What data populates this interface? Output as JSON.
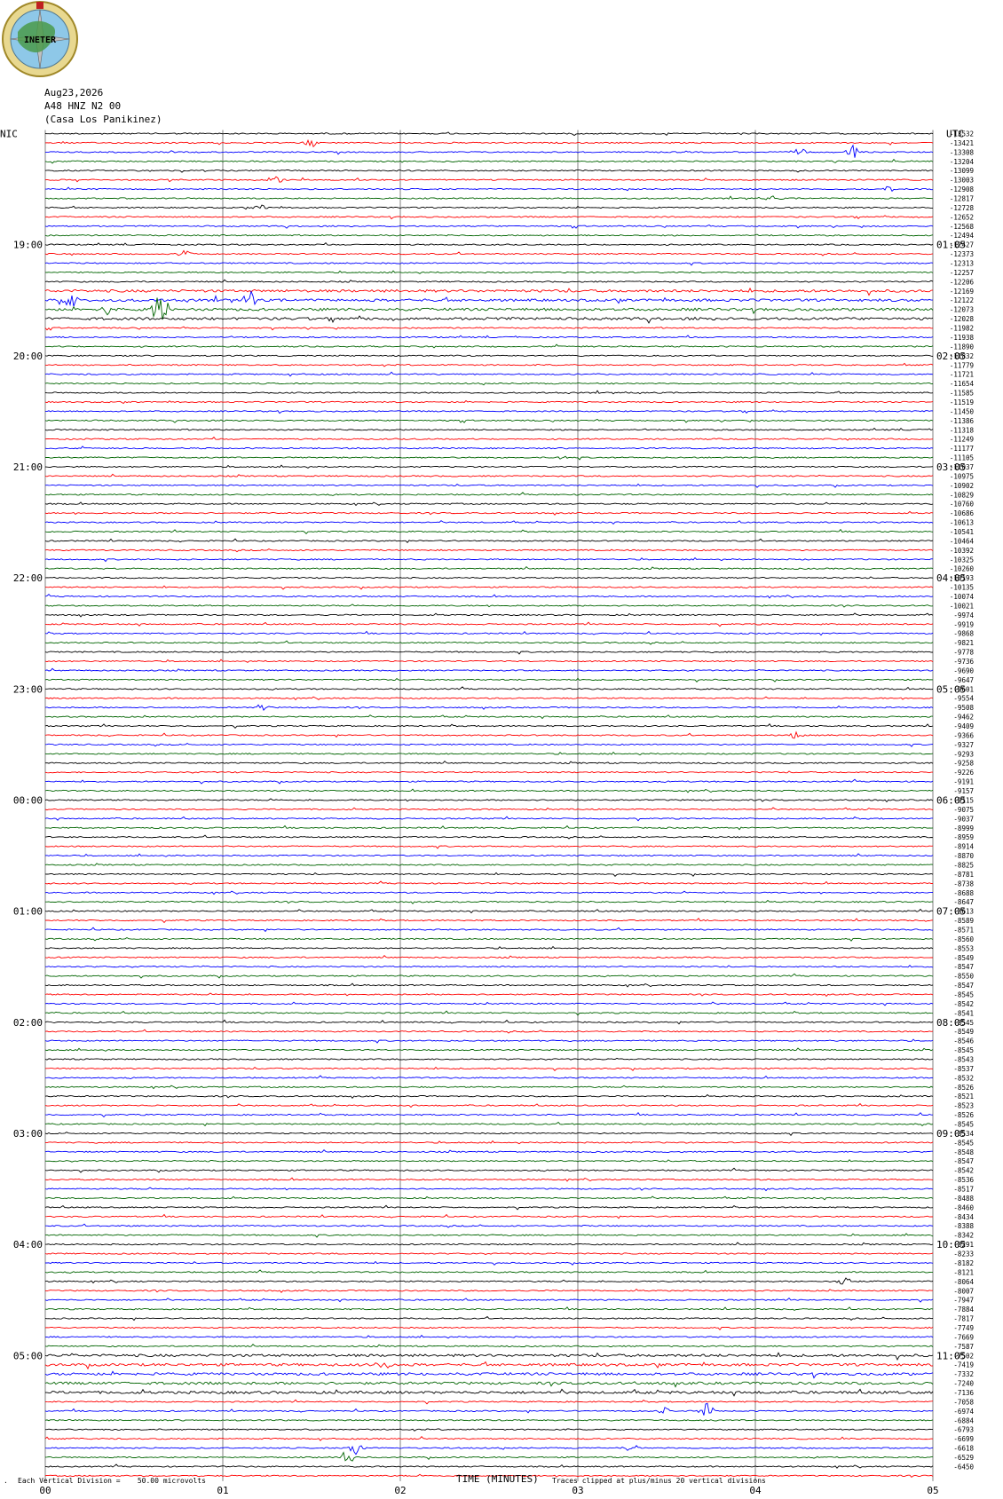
{
  "header": {
    "date": "Aug23,2026",
    "station": "A48 HNZ N2 00",
    "site": "(Casa Los Panikinez)",
    "logo_text": "INETER"
  },
  "left_zone": "NIC",
  "right_zone": "UTC",
  "colors": {
    "trace": [
      "#000000",
      "#ff0000",
      "#0000ff",
      "#006400"
    ],
    "grid": "#808080"
  },
  "footer": {
    "division": "Each Vertical Division =    50.00 microvolts",
    "xlabel": "TIME (MINUTES)",
    "clip": "Traces clipped at plus/minus 20 vertical divisions"
  },
  "chart_data": {
    "type": "line",
    "xlabel": "TIME (MINUTES)",
    "xlim": [
      0,
      5
    ],
    "x_ticks": [
      "00",
      "01",
      "02",
      "03",
      "04",
      "05"
    ],
    "rows": 146,
    "color_cycle": [
      "black",
      "red",
      "blue",
      "green"
    ],
    "left_hour_labels": [
      {
        "row": 12,
        "label": "19:00"
      },
      {
        "row": 24,
        "label": "20:00"
      },
      {
        "row": 36,
        "label": "21:00"
      },
      {
        "row": 48,
        "label": "22:00"
      },
      {
        "row": 60,
        "label": "23:00"
      },
      {
        "row": 72,
        "label": "00:00"
      },
      {
        "row": 84,
        "label": "01:00"
      },
      {
        "row": 96,
        "label": "02:00"
      },
      {
        "row": 108,
        "label": "03:00"
      },
      {
        "row": 120,
        "label": "04:00"
      },
      {
        "row": 132,
        "label": "05:00"
      }
    ],
    "right_hour_labels": [
      {
        "row": 12,
        "label": "01:05"
      },
      {
        "row": 24,
        "label": "02:05"
      },
      {
        "row": 36,
        "label": "03:05"
      },
      {
        "row": 48,
        "label": "04:05"
      },
      {
        "row": 60,
        "label": "05:05"
      },
      {
        "row": 72,
        "label": "06:05"
      },
      {
        "row": 84,
        "label": "07:05"
      },
      {
        "row": 96,
        "label": "08:05"
      },
      {
        "row": 108,
        "label": "09:05"
      },
      {
        "row": 120,
        "label": "10:05"
      },
      {
        "row": 132,
        "label": "11:05"
      }
    ],
    "row_offsets": [
      "-13532",
      "-13421",
      "-13308",
      "-13204",
      "-13099",
      "-13003",
      "-12908",
      "-12817",
      "-12728",
      "-12652",
      "-12568",
      "-12494",
      "-12427",
      "-12373",
      "-12313",
      "-12257",
      "-12206",
      "-12169",
      "-12122",
      "-12073",
      "-12028",
      "-11982",
      "-11938",
      "-11890",
      "-11832",
      "-11779",
      "-11721",
      "-11654",
      "-11585",
      "-11519",
      "-11450",
      "-11386",
      "-11318",
      "-11249",
      "-11177",
      "-11105",
      "-11037",
      "-10975",
      "-10902",
      "-10829",
      "-10760",
      "-10686",
      "-10613",
      "-10541",
      "-10464",
      "-10392",
      "-10325",
      "-10260",
      "-10193",
      "-10135",
      "-10074",
      "-10021",
      "-9974",
      "-9919",
      "-9868",
      "-9821",
      "-9778",
      "-9736",
      "-9690",
      "-9647",
      "-9601",
      "-9554",
      "-9508",
      "-9462",
      "-9409",
      "-9366",
      "-9327",
      "-9293",
      "-9258",
      "-9226",
      "-9191",
      "-9157",
      "-9115",
      "-9075",
      "-9037",
      "-8999",
      "-8959",
      "-8914",
      "-8870",
      "-8825",
      "-8781",
      "-8738",
      "-8688",
      "-8647",
      "-8613",
      "-8589",
      "-8571",
      "-8560",
      "-8553",
      "-8549",
      "-8547",
      "-8550",
      "-8547",
      "-8545",
      "-8542",
      "-8541",
      "-8545",
      "-8549",
      "-8546",
      "-8545",
      "-8543",
      "-8537",
      "-8532",
      "-8526",
      "-8521",
      "-8523",
      "-8526",
      "-8545",
      "-8534",
      "-8545",
      "-8548",
      "-8547",
      "-8542",
      "-8536",
      "-8517",
      "-8488",
      "-8460",
      "-8434",
      "-8388",
      "-8342",
      "-8291",
      "-8233",
      "-8182",
      "-8121",
      "-8064",
      "-8007",
      "-7947",
      "-7884",
      "-7817",
      "-7749",
      "-7669",
      "-7587",
      "-7502",
      "-7419",
      "-7332",
      "-7240",
      "-7136",
      "-7058",
      "-6974",
      "-6884",
      "-6793",
      "-6699",
      "-6618",
      "-6529",
      "-6450"
    ],
    "events": [
      {
        "row": 1,
        "minute": 1.5,
        "amp": 6
      },
      {
        "row": 2,
        "minute": 4.55,
        "amp": 8
      },
      {
        "row": 2,
        "minute": 4.25,
        "amp": 5
      },
      {
        "row": 5,
        "minute": 1.3,
        "amp": 5
      },
      {
        "row": 6,
        "minute": 4.75,
        "amp": 4
      },
      {
        "row": 7,
        "minute": 4.1,
        "amp": 4
      },
      {
        "row": 8,
        "minute": 1.22,
        "amp": 4
      },
      {
        "row": 13,
        "minute": 0.78,
        "amp": 4
      },
      {
        "row": 18,
        "minute": 0.15,
        "amp": 9
      },
      {
        "row": 18,
        "minute": 1.15,
        "amp": 12
      },
      {
        "row": 19,
        "minute": 0.65,
        "amp": 26
      },
      {
        "row": 19,
        "minute": 0.35,
        "amp": 6
      },
      {
        "row": 35,
        "minute": 2.9,
        "amp": 3
      },
      {
        "row": 62,
        "minute": 1.22,
        "amp": 4
      },
      {
        "row": 65,
        "minute": 4.22,
        "amp": 5
      },
      {
        "row": 124,
        "minute": 4.5,
        "amp": 6
      },
      {
        "row": 133,
        "minute": 1.9,
        "amp": 6
      },
      {
        "row": 135,
        "minute": 0.95,
        "amp": 5
      },
      {
        "row": 138,
        "minute": 3.5,
        "amp": 5
      },
      {
        "row": 138,
        "minute": 3.72,
        "amp": 10
      },
      {
        "row": 142,
        "minute": 1.75,
        "amp": 9
      },
      {
        "row": 142,
        "minute": 3.3,
        "amp": 5
      },
      {
        "row": 143,
        "minute": 1.7,
        "amp": 8
      }
    ]
  }
}
